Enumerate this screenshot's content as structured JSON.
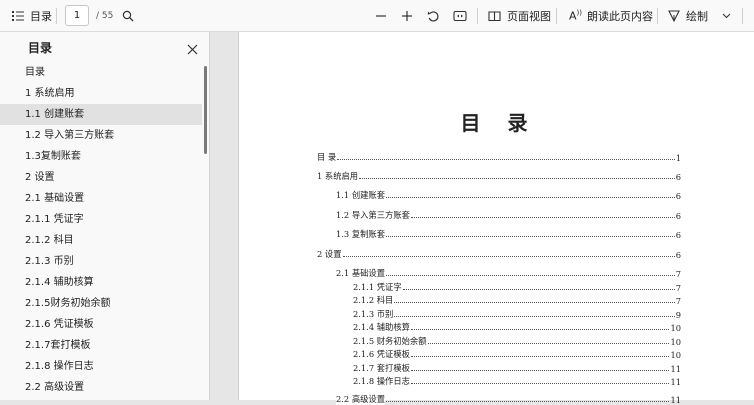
{
  "toolbar": {
    "toc_label": "目录",
    "current_page": "1",
    "total_pages": "/ 55",
    "page_view_label": "页面视图",
    "read_aloud_label": "朗读此页内容",
    "draw_label": "绘制"
  },
  "sidebar": {
    "title": "目录",
    "items": [
      {
        "label": "目录"
      },
      {
        "label": "1 系统启用"
      },
      {
        "label": "1.1 创建账套"
      },
      {
        "label": "1.2 导入第三方账套"
      },
      {
        "label": "1.3复制账套"
      },
      {
        "label": "2 设置"
      },
      {
        "label": "2.1 基础设置"
      },
      {
        "label": "2.1.1 凭证字"
      },
      {
        "label": "2.1.2 科目"
      },
      {
        "label": "2.1.3 币别"
      },
      {
        "label": "2.1.4 辅助核算"
      },
      {
        "label": "2.1.5财务初始余额"
      },
      {
        "label": "2.1.6 凭证模板"
      },
      {
        "label": "2.1.7套打模板"
      },
      {
        "label": "2.1.8 操作日志"
      },
      {
        "label": "2.2 高级设置"
      }
    ]
  },
  "document": {
    "title": "目 录",
    "toc": [
      {
        "label": "目  录",
        "page": "1"
      },
      {
        "label": "1  系统启用",
        "page": "6"
      },
      {
        "label": "1.1  创建账套",
        "page": "6"
      },
      {
        "label": "1.2  导入第三方账套",
        "page": "6"
      },
      {
        "label": "1.3  复制账套",
        "page": "6"
      },
      {
        "label": "2  设置",
        "page": "6"
      },
      {
        "label": "2.1  基础设置",
        "page": "7"
      },
      {
        "label": "2.1.1  凭证字",
        "page": "7"
      },
      {
        "label": "2.1.2  科目",
        "page": "7"
      },
      {
        "label": "2.1.3  币别",
        "page": "9"
      },
      {
        "label": "2.1.4  辅助核算",
        "page": "10"
      },
      {
        "label": "2.1.5  财务初始余额",
        "page": "10"
      },
      {
        "label": "2.1.6  凭证模板",
        "page": "10"
      },
      {
        "label": "2.1.7  套打模板",
        "page": "11"
      },
      {
        "label": "2.1.8  操作日志",
        "page": "11"
      },
      {
        "label": "2.2  高级设置",
        "page": "11"
      }
    ]
  }
}
